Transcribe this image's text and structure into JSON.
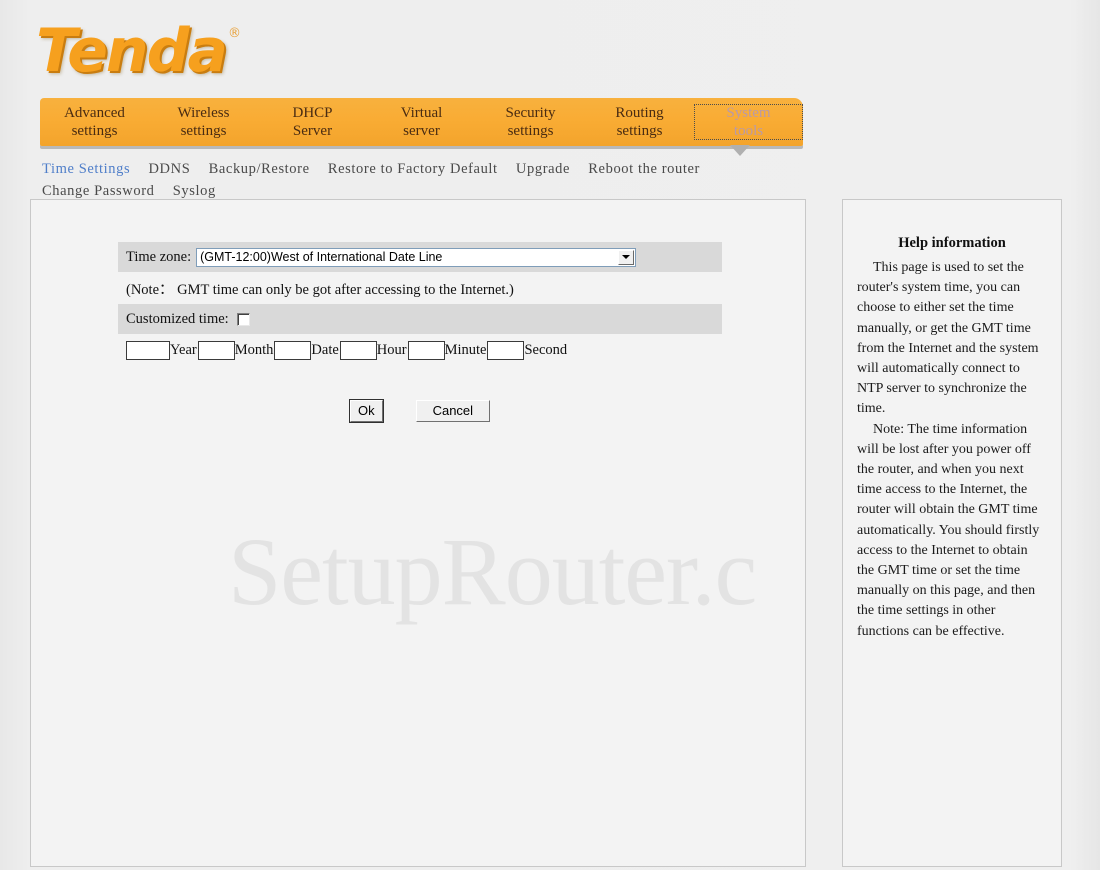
{
  "brand": {
    "logo_text": "Tenda",
    "registered_mark": "®"
  },
  "nav": {
    "items": [
      {
        "line1": "Advanced",
        "line2": "settings",
        "active": false
      },
      {
        "line1": "Wireless",
        "line2": "settings",
        "active": false
      },
      {
        "line1": "DHCP",
        "line2": "Server",
        "active": false
      },
      {
        "line1": "Virtual",
        "line2": "server",
        "active": false
      },
      {
        "line1": "Security",
        "line2": "settings",
        "active": false
      },
      {
        "line1": "Routing",
        "line2": "settings",
        "active": false
      },
      {
        "line1": "System",
        "line2": "tools",
        "active": true
      }
    ]
  },
  "subnav": {
    "items": [
      {
        "label": "Time Settings",
        "active": true
      },
      {
        "label": "DDNS",
        "active": false
      },
      {
        "label": "Backup/Restore",
        "active": false
      },
      {
        "label": "Restore to Factory Default",
        "active": false
      },
      {
        "label": "Upgrade",
        "active": false
      },
      {
        "label": "Reboot the router",
        "active": false
      },
      {
        "label": "Change Password",
        "active": false
      },
      {
        "label": "Syslog",
        "active": false
      }
    ]
  },
  "form": {
    "timezone_label": "Time zone:",
    "timezone_value": "(GMT-12:00)West of International Date Line",
    "note": "(Note： GMT time can only be got after accessing to the Internet.)",
    "customized_time_label": "Customized time:",
    "customized_time_checked": false,
    "fields": [
      {
        "unit": "Year",
        "value": "",
        "width": "year"
      },
      {
        "unit": "Month",
        "value": "",
        "width": "small"
      },
      {
        "unit": "Date",
        "value": "",
        "width": "small"
      },
      {
        "unit": "Hour",
        "value": "",
        "width": "small"
      },
      {
        "unit": "Minute",
        "value": "",
        "width": "small"
      },
      {
        "unit": "Second",
        "value": "",
        "width": "small"
      }
    ],
    "ok_label": "Ok",
    "cancel_label": "Cancel"
  },
  "help": {
    "title": "Help information",
    "paragraph1": "This page is used to set the router's system time, you can choose to either set the time manually, or get the GMT time from the Internet and the system will automatically connect to NTP server to synchronize the time.",
    "paragraph2": "Note: The time information will be lost after you power off the router, and when you next time access to the Internet, the router will obtain the GMT time automatically. You should firstly access to the Internet to obtain the GMT time or set the time manually on this page, and then the time settings in other functions can be effective."
  },
  "watermark": {
    "text": "SetupRouter.c"
  },
  "colors": {
    "nav_orange": "#f9ac34",
    "logo_orange": "#f6a01e",
    "active_subnav_blue": "#4f7ec9",
    "row_grey": "#d9d9d9",
    "panel_bg": "#f3f3f3",
    "page_bg": "#ececec"
  }
}
